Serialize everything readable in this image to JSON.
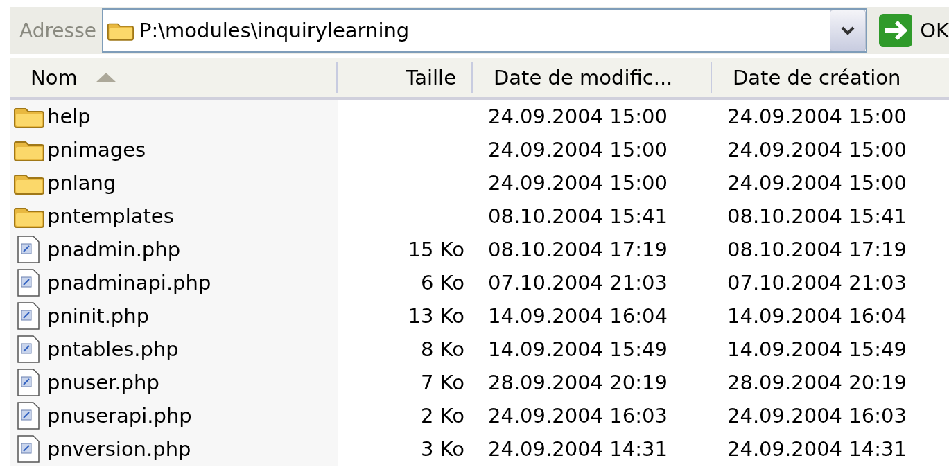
{
  "address_bar": {
    "label": "Adresse",
    "path": "P:\\modules\\inquirylearning",
    "go_button": "OK"
  },
  "columns": [
    {
      "label": "Nom",
      "sorted": true
    },
    {
      "label": "Taille",
      "sorted": false
    },
    {
      "label": "Date de modific...",
      "sorted": false
    },
    {
      "label": "Date de création",
      "sorted": false
    }
  ],
  "rows": [
    {
      "kind": "folder",
      "name": "help",
      "modified": "24.09.2004 15:00",
      "created": "24.09.2004 15:00"
    },
    {
      "kind": "folder",
      "name": "pnimages",
      "modified": "24.09.2004 15:00",
      "created": "24.09.2004 15:00"
    },
    {
      "kind": "folder",
      "name": "pnlang",
      "modified": "24.09.2004 15:00",
      "created": "24.09.2004 15:00"
    },
    {
      "kind": "folder",
      "name": "pntemplates",
      "modified": "08.10.2004 15:41",
      "created": "08.10.2004 15:41"
    },
    {
      "kind": "file",
      "name": "pnadmin.php",
      "size": "15 Ko",
      "modified": "08.10.2004 17:19",
      "created": "08.10.2004 17:19"
    },
    {
      "kind": "file",
      "name": "pnadminapi.php",
      "size": "6 Ko",
      "modified": "07.10.2004 21:03",
      "created": "07.10.2004 21:03"
    },
    {
      "kind": "file",
      "name": "pninit.php",
      "size": "13 Ko",
      "modified": "14.09.2004 16:04",
      "created": "14.09.2004 16:04"
    },
    {
      "kind": "file",
      "name": "pntables.php",
      "size": "8 Ko",
      "modified": "14.09.2004 15:49",
      "created": "14.09.2004 15:49"
    },
    {
      "kind": "file",
      "name": "pnuser.php",
      "size": "7 Ko",
      "modified": "28.09.2004 20:19",
      "created": "28.09.2004 20:19"
    },
    {
      "kind": "file",
      "name": "pnuserapi.php",
      "size": "2 Ko",
      "modified": "24.09.2004 16:03",
      "created": "24.09.2004 16:03"
    },
    {
      "kind": "file",
      "name": "pnversion.php",
      "size": "3 Ko",
      "modified": "24.09.2004 14:31",
      "created": "24.09.2004 14:31"
    }
  ]
}
